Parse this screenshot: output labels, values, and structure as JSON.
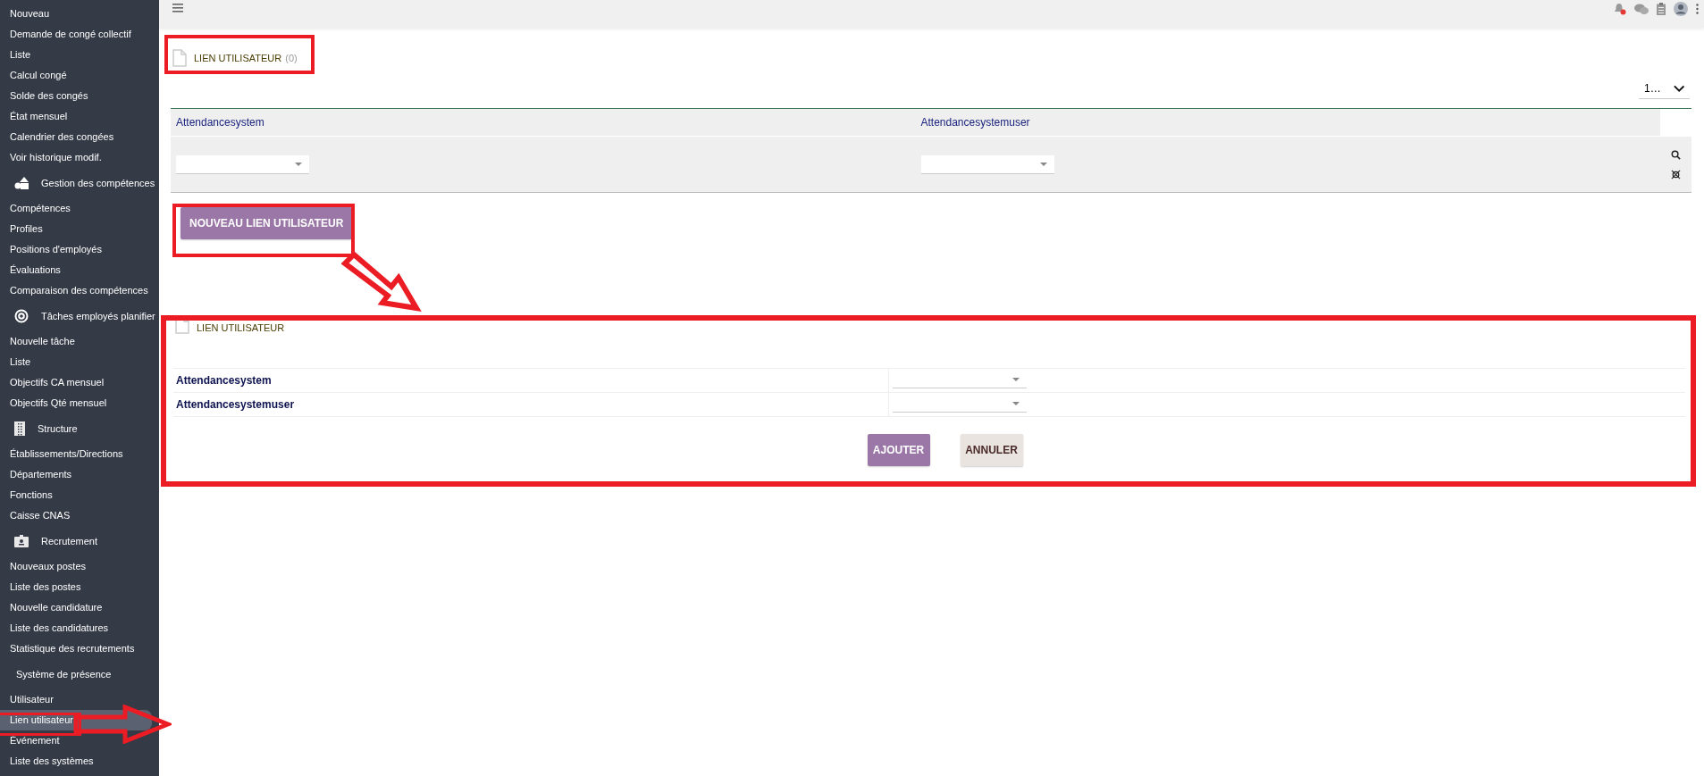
{
  "sidebar": {
    "items": [
      {
        "kind": "link",
        "label": "Nouveau",
        "selected": false
      },
      {
        "kind": "link",
        "label": "Demande de congé collectif",
        "selected": false
      },
      {
        "kind": "link",
        "label": "Liste",
        "selected": false
      },
      {
        "kind": "link",
        "label": "Calcul congé",
        "selected": false
      },
      {
        "kind": "link",
        "label": "Solde des congés",
        "selected": false
      },
      {
        "kind": "link",
        "label": "État mensuel",
        "selected": false
      },
      {
        "kind": "link",
        "label": "Calendrier des congées",
        "selected": false
      },
      {
        "kind": "link",
        "label": "Voir historique modif.",
        "selected": false
      },
      {
        "kind": "section",
        "label": "Gestion des compétences"
      },
      {
        "kind": "link",
        "label": "Compétences",
        "selected": false
      },
      {
        "kind": "link",
        "label": "Profiles",
        "selected": false
      },
      {
        "kind": "link",
        "label": "Positions d'employés",
        "selected": false
      },
      {
        "kind": "link",
        "label": "Évaluations",
        "selected": false
      },
      {
        "kind": "link",
        "label": "Comparaison des compétences",
        "selected": false
      },
      {
        "kind": "section",
        "label": "Tâches employés planifier"
      },
      {
        "kind": "link",
        "label": "Nouvelle tâche",
        "selected": false
      },
      {
        "kind": "link",
        "label": "Liste",
        "selected": false
      },
      {
        "kind": "link",
        "label": "Objectifs CA mensuel",
        "selected": false
      },
      {
        "kind": "link",
        "label": "Objectifs Qté mensuel",
        "selected": false
      },
      {
        "kind": "section",
        "label": "Structure"
      },
      {
        "kind": "link",
        "label": "Établissements/Directions",
        "selected": false
      },
      {
        "kind": "link",
        "label": "Départements",
        "selected": false
      },
      {
        "kind": "link",
        "label": "Fonctions",
        "selected": false
      },
      {
        "kind": "link",
        "label": "Caisse CNAS",
        "selected": false
      },
      {
        "kind": "section",
        "label": "Recrutement"
      },
      {
        "kind": "link",
        "label": "Nouveaux postes",
        "selected": false
      },
      {
        "kind": "link",
        "label": "Liste des postes",
        "selected": false
      },
      {
        "kind": "link",
        "label": "Nouvelle candidature",
        "selected": false
      },
      {
        "kind": "link",
        "label": "Liste des candidatures",
        "selected": false
      },
      {
        "kind": "link",
        "label": "Statistique des recrutements",
        "selected": false
      },
      {
        "kind": "section",
        "label": "Système de présence"
      },
      {
        "kind": "link",
        "label": "Utilisateur",
        "selected": false
      },
      {
        "kind": "link",
        "label": "Lien utilisateur",
        "selected": true
      },
      {
        "kind": "link",
        "label": "Événement",
        "selected": false
      },
      {
        "kind": "link",
        "label": "Liste des systèmes",
        "selected": false
      }
    ]
  },
  "page": {
    "title": "LIEN UTILISATEUR",
    "count": "(0)",
    "page_size": "1…"
  },
  "table": {
    "columns": [
      "Attendancesystem",
      "Attendancesystemuser"
    ]
  },
  "new_button": "NOUVEAU LIEN UTILISATEUR",
  "form": {
    "title": "LIEN UTILISATEUR",
    "fields": [
      "Attendancesystem",
      "Attendancesystemuser"
    ],
    "buttons": [
      {
        "kind": "primary",
        "label": "AJOUTER"
      },
      {
        "kind": "secondary",
        "label": "ANNULER"
      }
    ]
  }
}
